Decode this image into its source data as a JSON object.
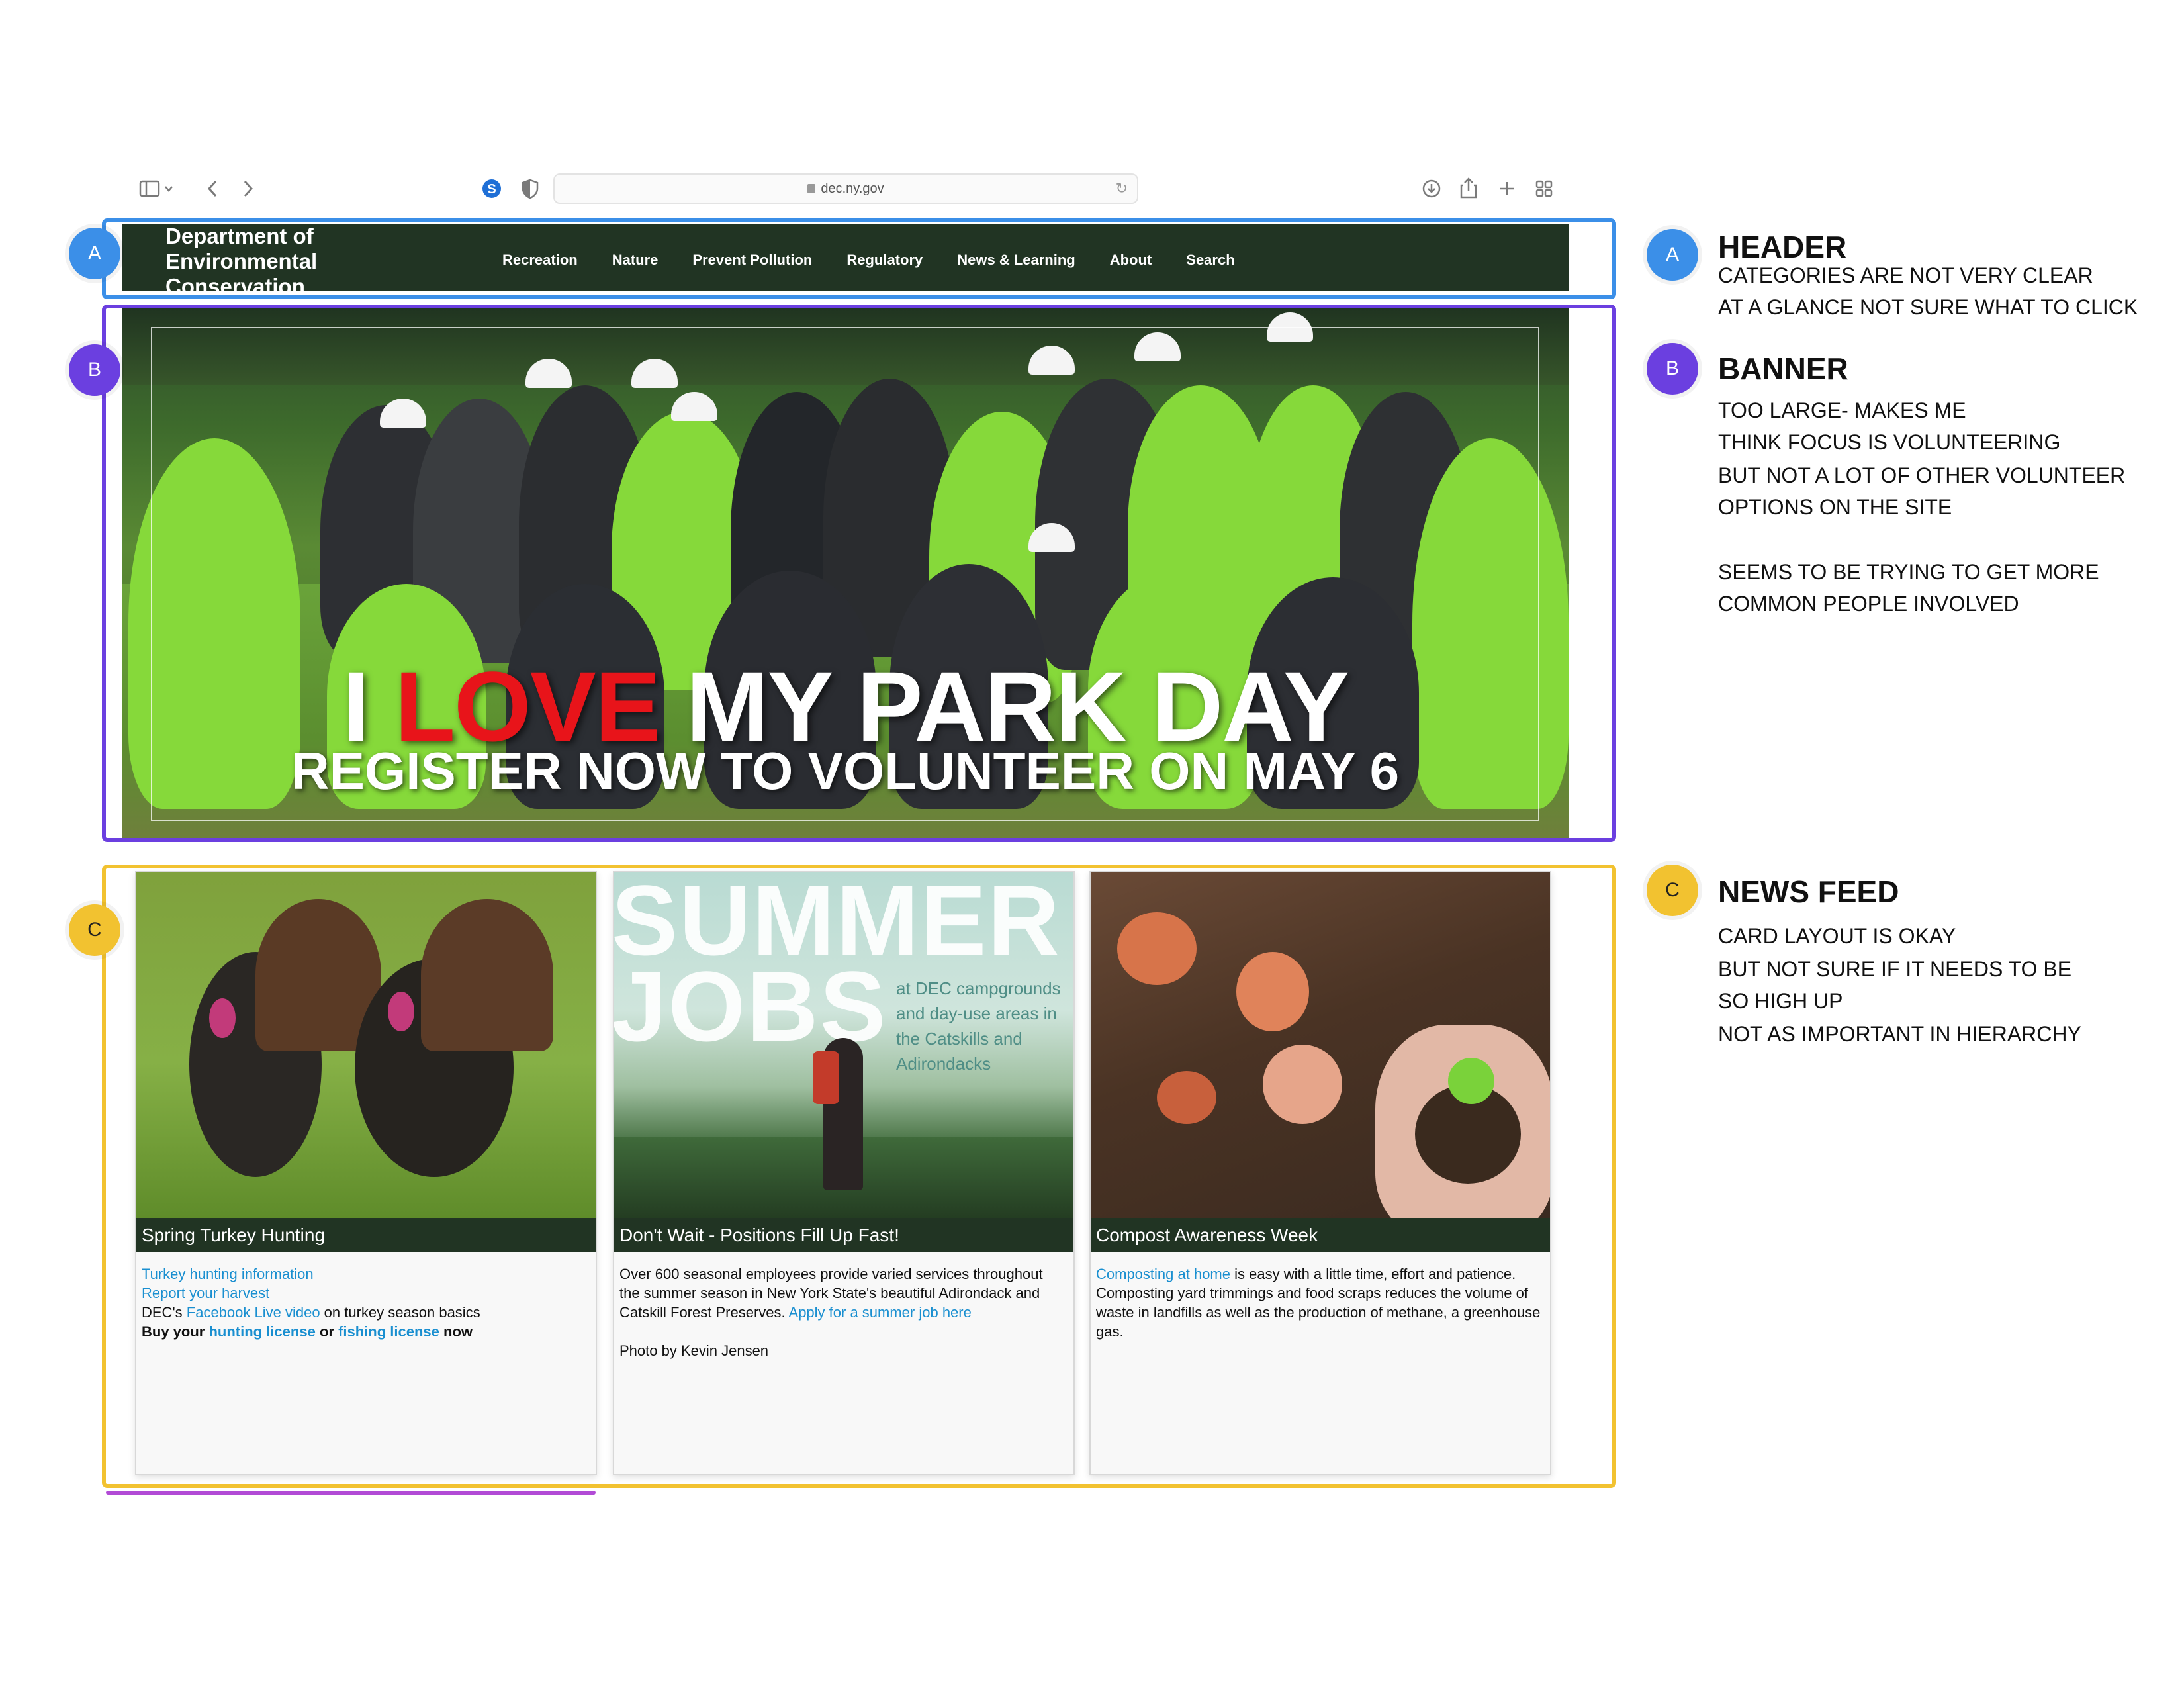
{
  "browser": {
    "url": "dec.ny.gov"
  },
  "site": {
    "brand_line1": "Department of",
    "brand_line2": "Environmental",
    "brand_line3": "Conservation",
    "nav": [
      "Recreation",
      "Nature",
      "Prevent Pollution",
      "Regulatory",
      "News & Learning",
      "About",
      "Search"
    ]
  },
  "banner": {
    "title_i": "I",
    "title_love": "LOVE",
    "title_rest": "MY PARK DAY",
    "subtitle": "REGISTER NOW TO VOLUNTEER ON MAY 6"
  },
  "cards": [
    {
      "caption": "Spring Turkey Hunting",
      "link1": "Turkey hunting information",
      "link2": "Report your harvest",
      "line3_prefix": "DEC's ",
      "line3_link": "Facebook Live video",
      "line3_suffix": " on turkey season basics",
      "line4_prefix": "Buy your ",
      "line4_link1": "hunting license",
      "line4_mid": " or ",
      "line4_link2": "fishing license",
      "line4_suffix": " now"
    },
    {
      "caption": "Don't Wait - Positions Fill Up Fast!",
      "img_title1": "SUMMER",
      "img_title2": "JOBS",
      "img_sub": "at DEC campgrounds and day-use areas in the Catskills and Adirondacks",
      "text": "Over 600 seasonal employees provide varied services throughout the summer season in New York State's beautiful Adirondack and Catskill Forest Preserves. ",
      "link": "Apply for a summer job here",
      "credit": "Photo by Kevin Jensen"
    },
    {
      "caption": "Compost Awareness Week",
      "link": "Composting at home",
      "text": " is easy with a little time, effort and patience. Composting yard trimmings and food scraps reduces the volume of waste in landfills as well as the production of methane, a greenhouse gas."
    }
  ],
  "annotations": [
    {
      "badge": "A",
      "title": "HEADER",
      "lines": [
        "CATEGORIES ARE NOT VERY CLEAR",
        "AT A GLANCE NOT SURE WHAT TO CLICK"
      ],
      "color": "#3b8fe8"
    },
    {
      "badge": "B",
      "title": "BANNER",
      "lines": [
        "TOO LARGE- MAKES ME",
        "THINK FOCUS IS VOLUNTEERING",
        "BUT NOT A LOT OF OTHER VOLUNTEER",
        "OPTIONS ON THE SITE",
        "",
        "SEEMS TO BE TRYING TO GET MORE",
        "COMMON PEOPLE INVOLVED"
      ],
      "color": "#6b3fe0"
    },
    {
      "badge": "C",
      "title": "NEWS FEED",
      "lines": [
        "CARD LAYOUT IS OKAY",
        "BUT NOT SURE IF IT NEEDS TO BE",
        "SO HIGH UP",
        "NOT AS IMPORTANT IN HIERARCHY"
      ],
      "color": "#f2c230"
    }
  ]
}
